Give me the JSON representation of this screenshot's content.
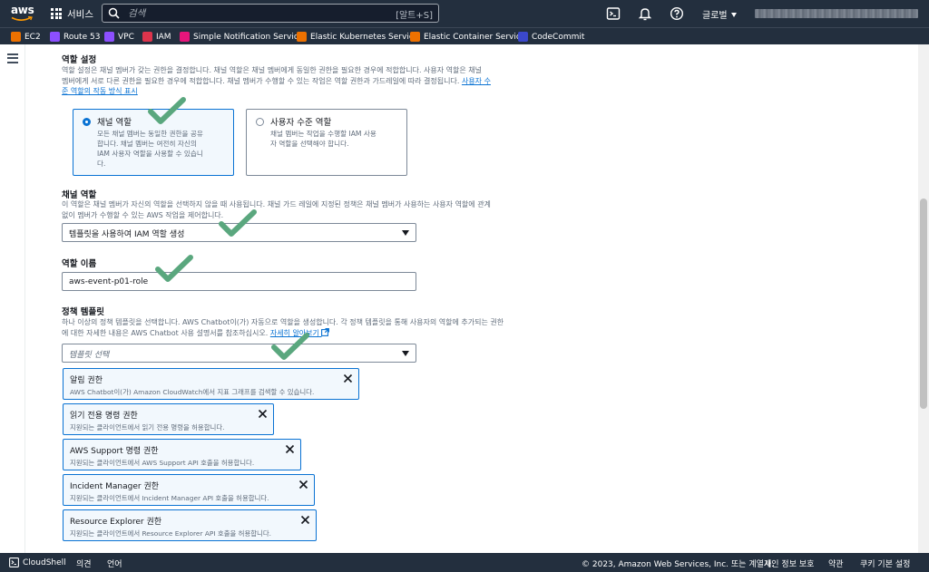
{
  "topnav": {
    "logo_text": "aws",
    "services_label": "서비스",
    "search_placeholder": "검색",
    "search_shortcut": "[알트+S]",
    "region_label": "글로벌"
  },
  "favorites": [
    {
      "label": "EC2",
      "color": "#ed7100"
    },
    {
      "label": "Route 53",
      "color": "#8c4fff"
    },
    {
      "label": "VPC",
      "color": "#8c4fff"
    },
    {
      "label": "IAM",
      "color": "#dd344c"
    },
    {
      "label": "Simple Notification Service",
      "color": "#e7157b"
    },
    {
      "label": "Elastic Kubernetes Service",
      "color": "#ed7100"
    },
    {
      "label": "Elastic Container Service",
      "color": "#ed7100"
    },
    {
      "label": "CodeCommit",
      "color": "#3b48cc"
    }
  ],
  "role_settings": {
    "title": "역할 설정",
    "description_line1": "역할 설정은 채널 멤버가 갖는 권한을 결정합니다. 채널 역할은 채널 멤버에게 동일한 권한을 필요한 경우에 적합합니다. 사용자 역할은 채널",
    "description_line2": "멤버에게 서로 다른 권한을 필요한 경우에 적합합니다. 채널 멤버가 수행할 수 있는 작업은 역할 권한과 가드레일에 따라 결정됩니다.",
    "link_text_part1": "사용자 수",
    "link_text_part2": "준 역할의 작동 방식 표시",
    "options": [
      {
        "title": "채널 역할",
        "desc_lines": [
          "모든 채널 멤버는 동일한 권한을 공유",
          "합니다. 채널 멤버는 여전히 자신의",
          "IAM 사용자 역할을 사용할 수 있습니",
          "다."
        ],
        "selected": true
      },
      {
        "title": "사용자 수준 역할",
        "desc_lines": [
          "채널 멤버는 작업을 수행할 IAM 사용",
          "자 역할을 선택해야 합니다."
        ],
        "selected": false
      }
    ]
  },
  "channel_role": {
    "title": "채널 역할",
    "description_line1": "이 역할은 채널 멤버가 자신의 역할을 선택하지 않을 때 사용됩니다. 채널 가드 레일에 지정된 정책은 채널 멤버가 사용하는 사용자 역할에 관계",
    "description_line2": "없이 멤버가 수행할 수 있는 AWS 작업을 제어합니다.",
    "select_value": "템플릿을 사용하여 IAM 역할 생성"
  },
  "role_name": {
    "title": "역할 이름",
    "value": "aws-event-p01-role"
  },
  "policy_templates": {
    "title": "정책 템플릿",
    "description_line1": "하나 이상의 정책 템플릿을 선택합니다. AWS Chatbot이(가) 자동으로 역할을 생성합니다. 각 정책 템플릿을 통해 사용자의 역할에 추가되는 권한",
    "description_line2": "에 대한 자세한 내용은 AWS Chatbot 사용 설명서를 참조하십시오.",
    "learn_more": "자세히 알아보기",
    "select_placeholder": "템플릿 선택",
    "tokens": [
      {
        "name": "알림 권한",
        "desc": "AWS Chatbot이(가) Amazon CloudWatch에서 지표 그래프를 검색할 수 있습니다."
      },
      {
        "name": "읽기 전용 명령 권한",
        "desc": "지원되는 클라이언트에서 읽기 전용 명령을 허용합니다."
      },
      {
        "name": "AWS Support 명령 권한",
        "desc": "지원되는 클라이언트에서 AWS Support API 호출을 허용합니다."
      },
      {
        "name": "Incident Manager 권한",
        "desc": "지원되는 클라이언트에서 Incident Manager API 호출을 허용합니다."
      },
      {
        "name": "Resource Explorer 권한",
        "desc": "지원되는 클라이언트에서 Resource Explorer API 호출을 허용합니다."
      }
    ]
  },
  "footer": {
    "cloudshell": "CloudShell",
    "feedback": "의견",
    "language": "언어",
    "copyright": "© 2023, Amazon Web Services, Inc. 또는 계열사.",
    "privacy": "개인 정보 보호",
    "terms": "약관",
    "cookies": "쿠키 기본 설정"
  }
}
